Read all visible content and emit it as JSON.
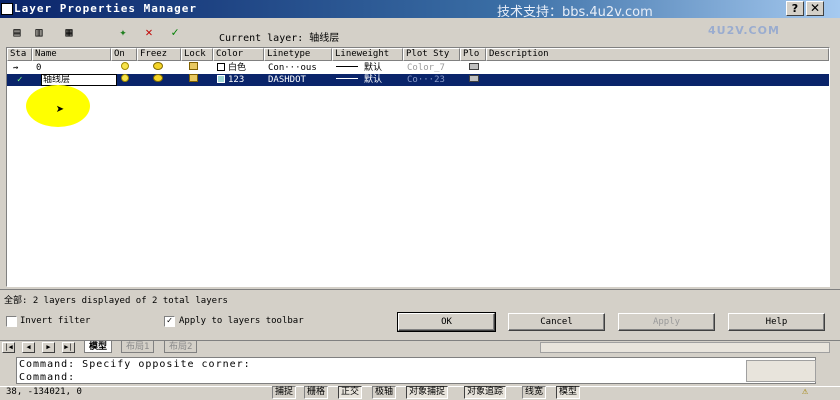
{
  "window": {
    "title": "Layer Properties Manager",
    "watermark": "技术支持：bbs.4u2v.com",
    "watermark_logo": "4U2V.COM",
    "help_button": "?",
    "close_button": "✕"
  },
  "toolbar": {
    "current_layer_label": "Current layer: 轴线层"
  },
  "table": {
    "columns": [
      "Sta",
      "Name",
      "On",
      "Freez",
      "Lock",
      "Color",
      "Linetype",
      "Lineweight",
      "Plot Sty",
      "Plo",
      "Description"
    ],
    "rows": [
      {
        "status": "",
        "name": "0",
        "color": "白色",
        "color_hex": "#ffffff",
        "linetype": "Con···ous",
        "lineweight": "默认",
        "plot_style": "Color_7",
        "selected": false
      },
      {
        "status": "✓",
        "name": "轴线层",
        "color": "123",
        "color_hex": "#9fd6d6",
        "linetype": "DASHDOT",
        "lineweight": "默认",
        "plot_style": "Co···23",
        "selected": true
      }
    ]
  },
  "summary": "全部: 2 layers displayed of 2 total layers",
  "options": {
    "invert_filter": {
      "label": "Invert filter",
      "checked": false
    },
    "apply_toolbar": {
      "label": "Apply to layers toolbar",
      "checked": true
    }
  },
  "buttons": {
    "ok": "OK",
    "cancel": "Cancel",
    "apply": "Apply",
    "help": "Help"
  },
  "layout_tabs": [
    "模型",
    "布局1",
    "布局2"
  ],
  "command": {
    "line1": "Command:  Specify opposite corner:",
    "line2": "Command:"
  },
  "status": {
    "coords": "38,      -134021, 0",
    "toggles": [
      "捕捉",
      "栅格",
      "正交",
      "极轴",
      "对象捕捉",
      "对象追踪",
      "线宽",
      "模型"
    ]
  },
  "colors": {
    "title_start": "#0a246a",
    "selection": "#0a246a",
    "cursor_highlight": "#ffff00"
  }
}
